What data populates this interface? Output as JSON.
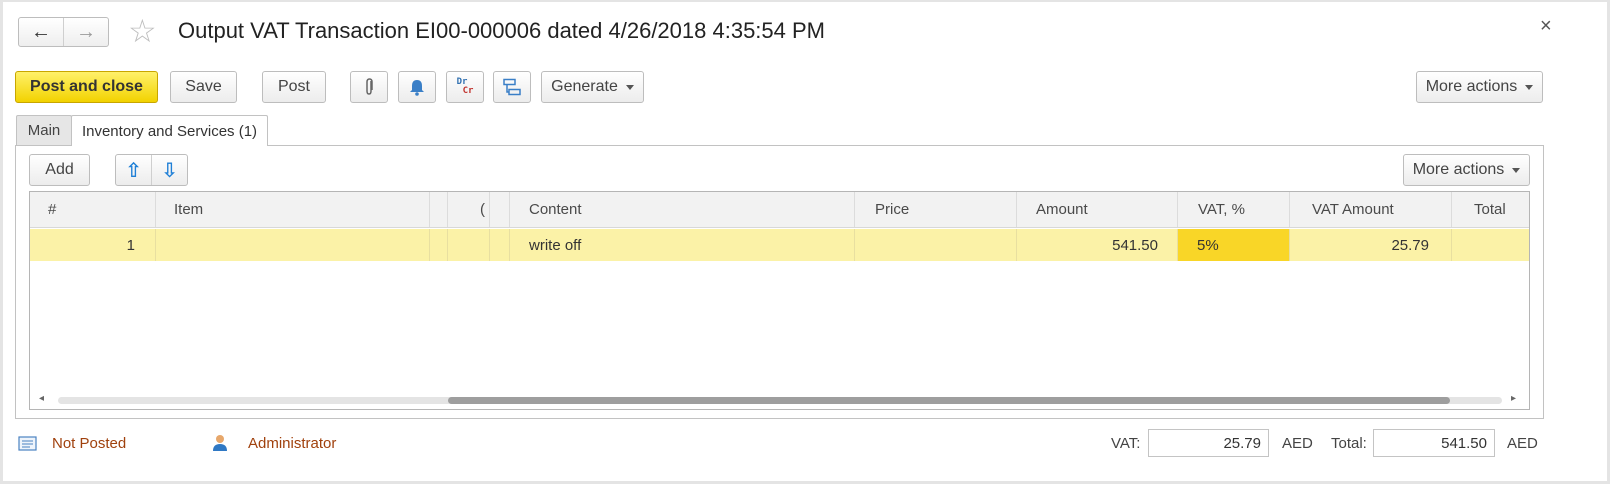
{
  "window": {
    "title": "Output VAT Transaction EI00-000006 dated 4/26/2018 4:35:54 PM",
    "back_icon": "←",
    "forward_icon": "→",
    "favorite_icon": "☆",
    "close_icon": "×"
  },
  "toolbar": {
    "post_and_close": "Post and close",
    "save": "Save",
    "post": "Post",
    "generate": "Generate",
    "more_actions": "More actions",
    "dr_label": "Dr",
    "cr_label": "Cr"
  },
  "tabs": [
    {
      "label": "Main",
      "active": false
    },
    {
      "label": "Inventory and Services (1)",
      "active": true
    }
  ],
  "table_toolbar": {
    "add": "Add",
    "up_icon": "⇧",
    "down_icon": "⇩",
    "more_actions": "More actions"
  },
  "table": {
    "columns": [
      "#",
      "Item",
      "",
      "(",
      "",
      "Content",
      "Price",
      "Amount",
      "VAT, %",
      "VAT Amount",
      "Total"
    ],
    "rows": [
      {
        "num": "1",
        "item": "",
        "c1": "",
        "c2": "",
        "c3": "",
        "content": "write off",
        "price": "",
        "amount": "541.50",
        "vat_rate": "5%",
        "vat_amount": "25.79",
        "total": ""
      }
    ],
    "scroll_left": "◂",
    "scroll_right": "▸"
  },
  "footer": {
    "status": "Not Posted",
    "user": "Administrator",
    "vat_label": "VAT:",
    "vat_value": "25.79",
    "vat_currency": "AED",
    "total_label": "Total:",
    "total_value": "541.50",
    "total_currency": "AED"
  },
  "colors": {
    "primary_button": "#f2d200",
    "row_highlight": "#fbf2a7",
    "selected_cell": "#f9d627",
    "link": "#a0410d"
  }
}
